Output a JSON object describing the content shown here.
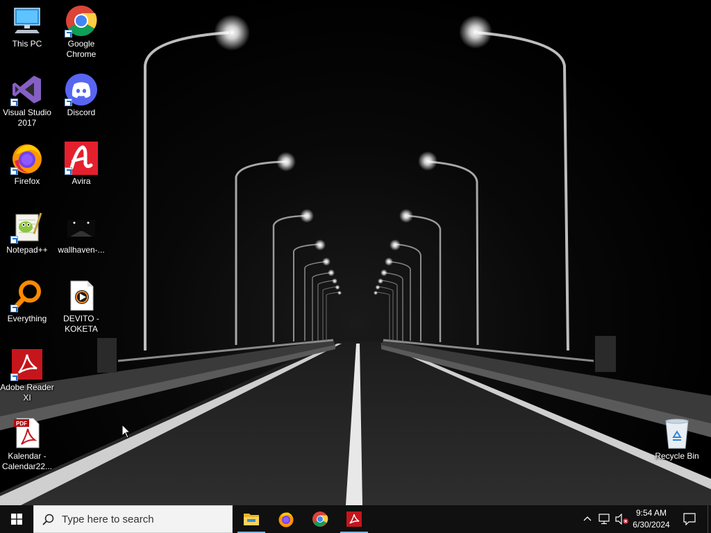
{
  "desktop": {
    "icons": [
      {
        "label": "This PC",
        "icon": "this-pc-icon"
      },
      {
        "label": "Google Chrome",
        "icon": "chrome-icon"
      },
      {
        "label": "Visual Studio 2017",
        "icon": "visual-studio-icon"
      },
      {
        "label": "Discord",
        "icon": "discord-icon"
      },
      {
        "label": "Firefox",
        "icon": "firefox-icon"
      },
      {
        "label": "Avira",
        "icon": "avira-icon"
      },
      {
        "label": "Notepad++",
        "icon": "notepadpp-icon"
      },
      {
        "label": "wallhaven-...",
        "icon": "image-file-icon"
      },
      {
        "label": "Everything",
        "icon": "everything-icon"
      },
      {
        "label": "DEVITO - KOKETA",
        "icon": "media-file-icon"
      },
      {
        "label": "Adobe Reader XI",
        "icon": "adobe-reader-icon"
      },
      {
        "label": "Kalendar - Calendar22...",
        "icon": "pdf-file-icon"
      },
      {
        "label": "Recycle Bin",
        "icon": "recycle-bin-icon"
      }
    ]
  },
  "taskbar": {
    "search_placeholder": "Type here to search",
    "pinned": [
      {
        "name": "File Explorer",
        "icon": "file-explorer-icon"
      },
      {
        "name": "Firefox",
        "icon": "firefox-icon"
      },
      {
        "name": "Google Chrome",
        "icon": "chrome-icon"
      },
      {
        "name": "Adobe Reader",
        "icon": "adobe-reader-icon"
      }
    ],
    "clock_time": "9:54 AM",
    "clock_date": "6/30/2024"
  },
  "colors": {
    "taskbar_bg": "#101010",
    "accent": "#76b9ed"
  }
}
